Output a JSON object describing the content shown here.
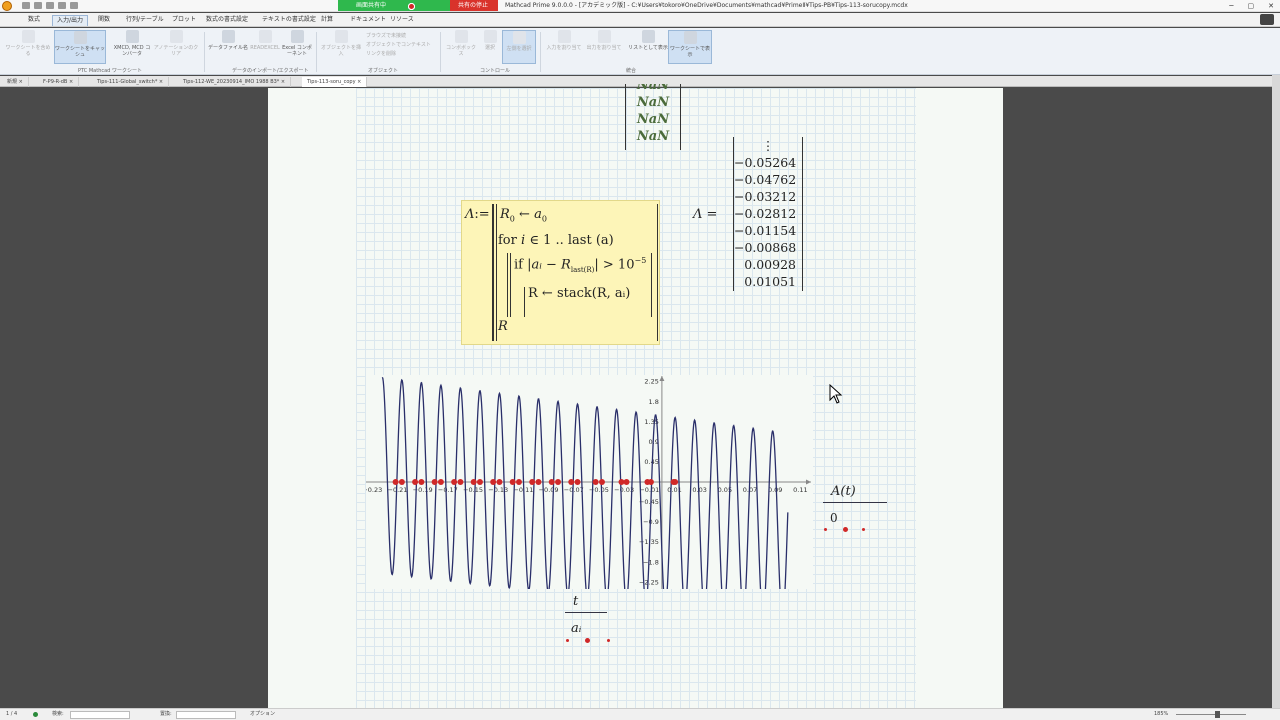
{
  "window": {
    "share_status": "画面共有中",
    "stop_share": "共有の停止",
    "title": "Mathcad Prime 9.0.0.0 - [アカデミック版] - C:¥Users¥tokoro¥OneDrive¥Documents¥mathcad¥PrimeⅡ¥Tips-PB¥Tips-113-sorucopy.mcdx",
    "controls": [
      "─",
      "▢",
      "✕"
    ]
  },
  "menu": {
    "tabs": [
      "数式",
      "入力/出力",
      "関数",
      "行列/テーブル",
      "プロット",
      "数式の書式設定",
      "テキストの書式設定",
      "計算",
      "ドキュメント",
      "リソース"
    ],
    "active": "入力/出力"
  },
  "ribbon": {
    "buttons": [
      {
        "label": "ワークシートを含める"
      },
      {
        "label": "ワークシートをキャッシュ"
      },
      {
        "label": "XMCD, MCD コンバータ"
      },
      {
        "label": "アノテーションのクリア"
      },
      {
        "label": "データファイル名"
      },
      {
        "label": "READEXCEL"
      },
      {
        "label": "Excel コンポーネント"
      },
      {
        "label": "オブジェクトを挿入"
      },
      {
        "label": "コンボボックス"
      },
      {
        "label": "選択"
      },
      {
        "label": "左側を選択"
      },
      {
        "label": "入力を割り当て"
      },
      {
        "label": "出力を割り当て"
      },
      {
        "label": "リストとして表示"
      },
      {
        "label": "ワークシートで表示"
      }
    ],
    "small_items": [
      "ブラウズで未接続",
      "オブジェクトでコンテキスト",
      "リンクを削除"
    ],
    "groups": [
      "PTC Mathcad ワークシート",
      "データのインポート/エクスポート",
      "オブジェクト",
      "コントロール",
      "統合"
    ]
  },
  "doc_tabs": [
    "新規",
    "F-P9-R-dB",
    "Tips-111-Global_switch*",
    "Tips-112-WE_20230914_IMO 1988 B3*",
    "Tips-113-soru_copy"
  ],
  "doc_tab_close": "×",
  "worksheet": {
    "nan_values": [
      "NaN",
      "NaN",
      "NaN",
      "NaN"
    ],
    "program": {
      "lhs": "Λ",
      "assign": ":=",
      "line1": "R₀ ← a₀",
      "line2_for": "for",
      "line2_var": "i",
      "line2_in": "∈ 1 .. last",
      "line2_arg": "(a)",
      "line3_if": "if",
      "line3_expr": "|aᵢ − R",
      "line3_sub": "last(R)",
      "line3_tail": "| > 10",
      "line3_exp": "−5",
      "line4": "R ← stack(R, aᵢ)",
      "line5": "R"
    },
    "result": {
      "lhs": "Λ",
      "eq": "=",
      "vdots": "⋮",
      "values": [
        "−0.05264",
        "−0.04762",
        "−0.03212",
        "−0.02812",
        "−0.01154",
        "−0.00868",
        "0.00928",
        "0.01051"
      ]
    },
    "right_legend": {
      "label": "A(t)",
      "value": "0"
    },
    "bottom_legend": {
      "label": "t",
      "value": "aᵢ"
    }
  },
  "chart_data": {
    "type": "line",
    "x_ticks": [
      "−0.23",
      "−0.21",
      "−0.19",
      "−0.17",
      "−0.15",
      "−0.13",
      "−0.11",
      "−0.09",
      "−0.07",
      "−0.05",
      "−0.03",
      "−0.01",
      "0.01",
      "0.03",
      "0.05",
      "0.07",
      "0.09",
      "0.11"
    ],
    "y_ticks": [
      "2.25",
      "1.8",
      "1.35",
      "0.9",
      "0.45",
      "−0.45",
      "−0.9",
      "−1.35",
      "−1.8",
      "−2.25"
    ],
    "xlim": [
      -0.235,
      0.12
    ],
    "ylim": [
      -2.4,
      2.4
    ],
    "series": [
      {
        "kind": "curve",
        "color": "#2a2f6a",
        "x_start": -0.222,
        "x_end": 0.1,
        "amp_start": 2.2,
        "amp_end": 2.1,
        "offset_start": 0.15,
        "offset_end": -1.0,
        "period": 0.0155
      },
      {
        "kind": "points",
        "color": "#d02828",
        "x": [
          -0.2115,
          -0.2065,
          -0.196,
          -0.191,
          -0.1805,
          -0.1755,
          -0.165,
          -0.16,
          -0.1495,
          -0.1445,
          -0.134,
          -0.129,
          -0.1185,
          -0.1135,
          -0.103,
          -0.098,
          -0.0875,
          -0.0825,
          -0.072,
          -0.067,
          -0.0526,
          -0.0476,
          -0.0321,
          -0.0281,
          -0.0115,
          -0.0087,
          0.0093,
          0.0105
        ],
        "y": 0
      }
    ]
  },
  "status": {
    "page": "1 / 4",
    "search_label": "検索:",
    "replace_label": "置換:",
    "options": "オプション",
    "zoom": "185%"
  }
}
